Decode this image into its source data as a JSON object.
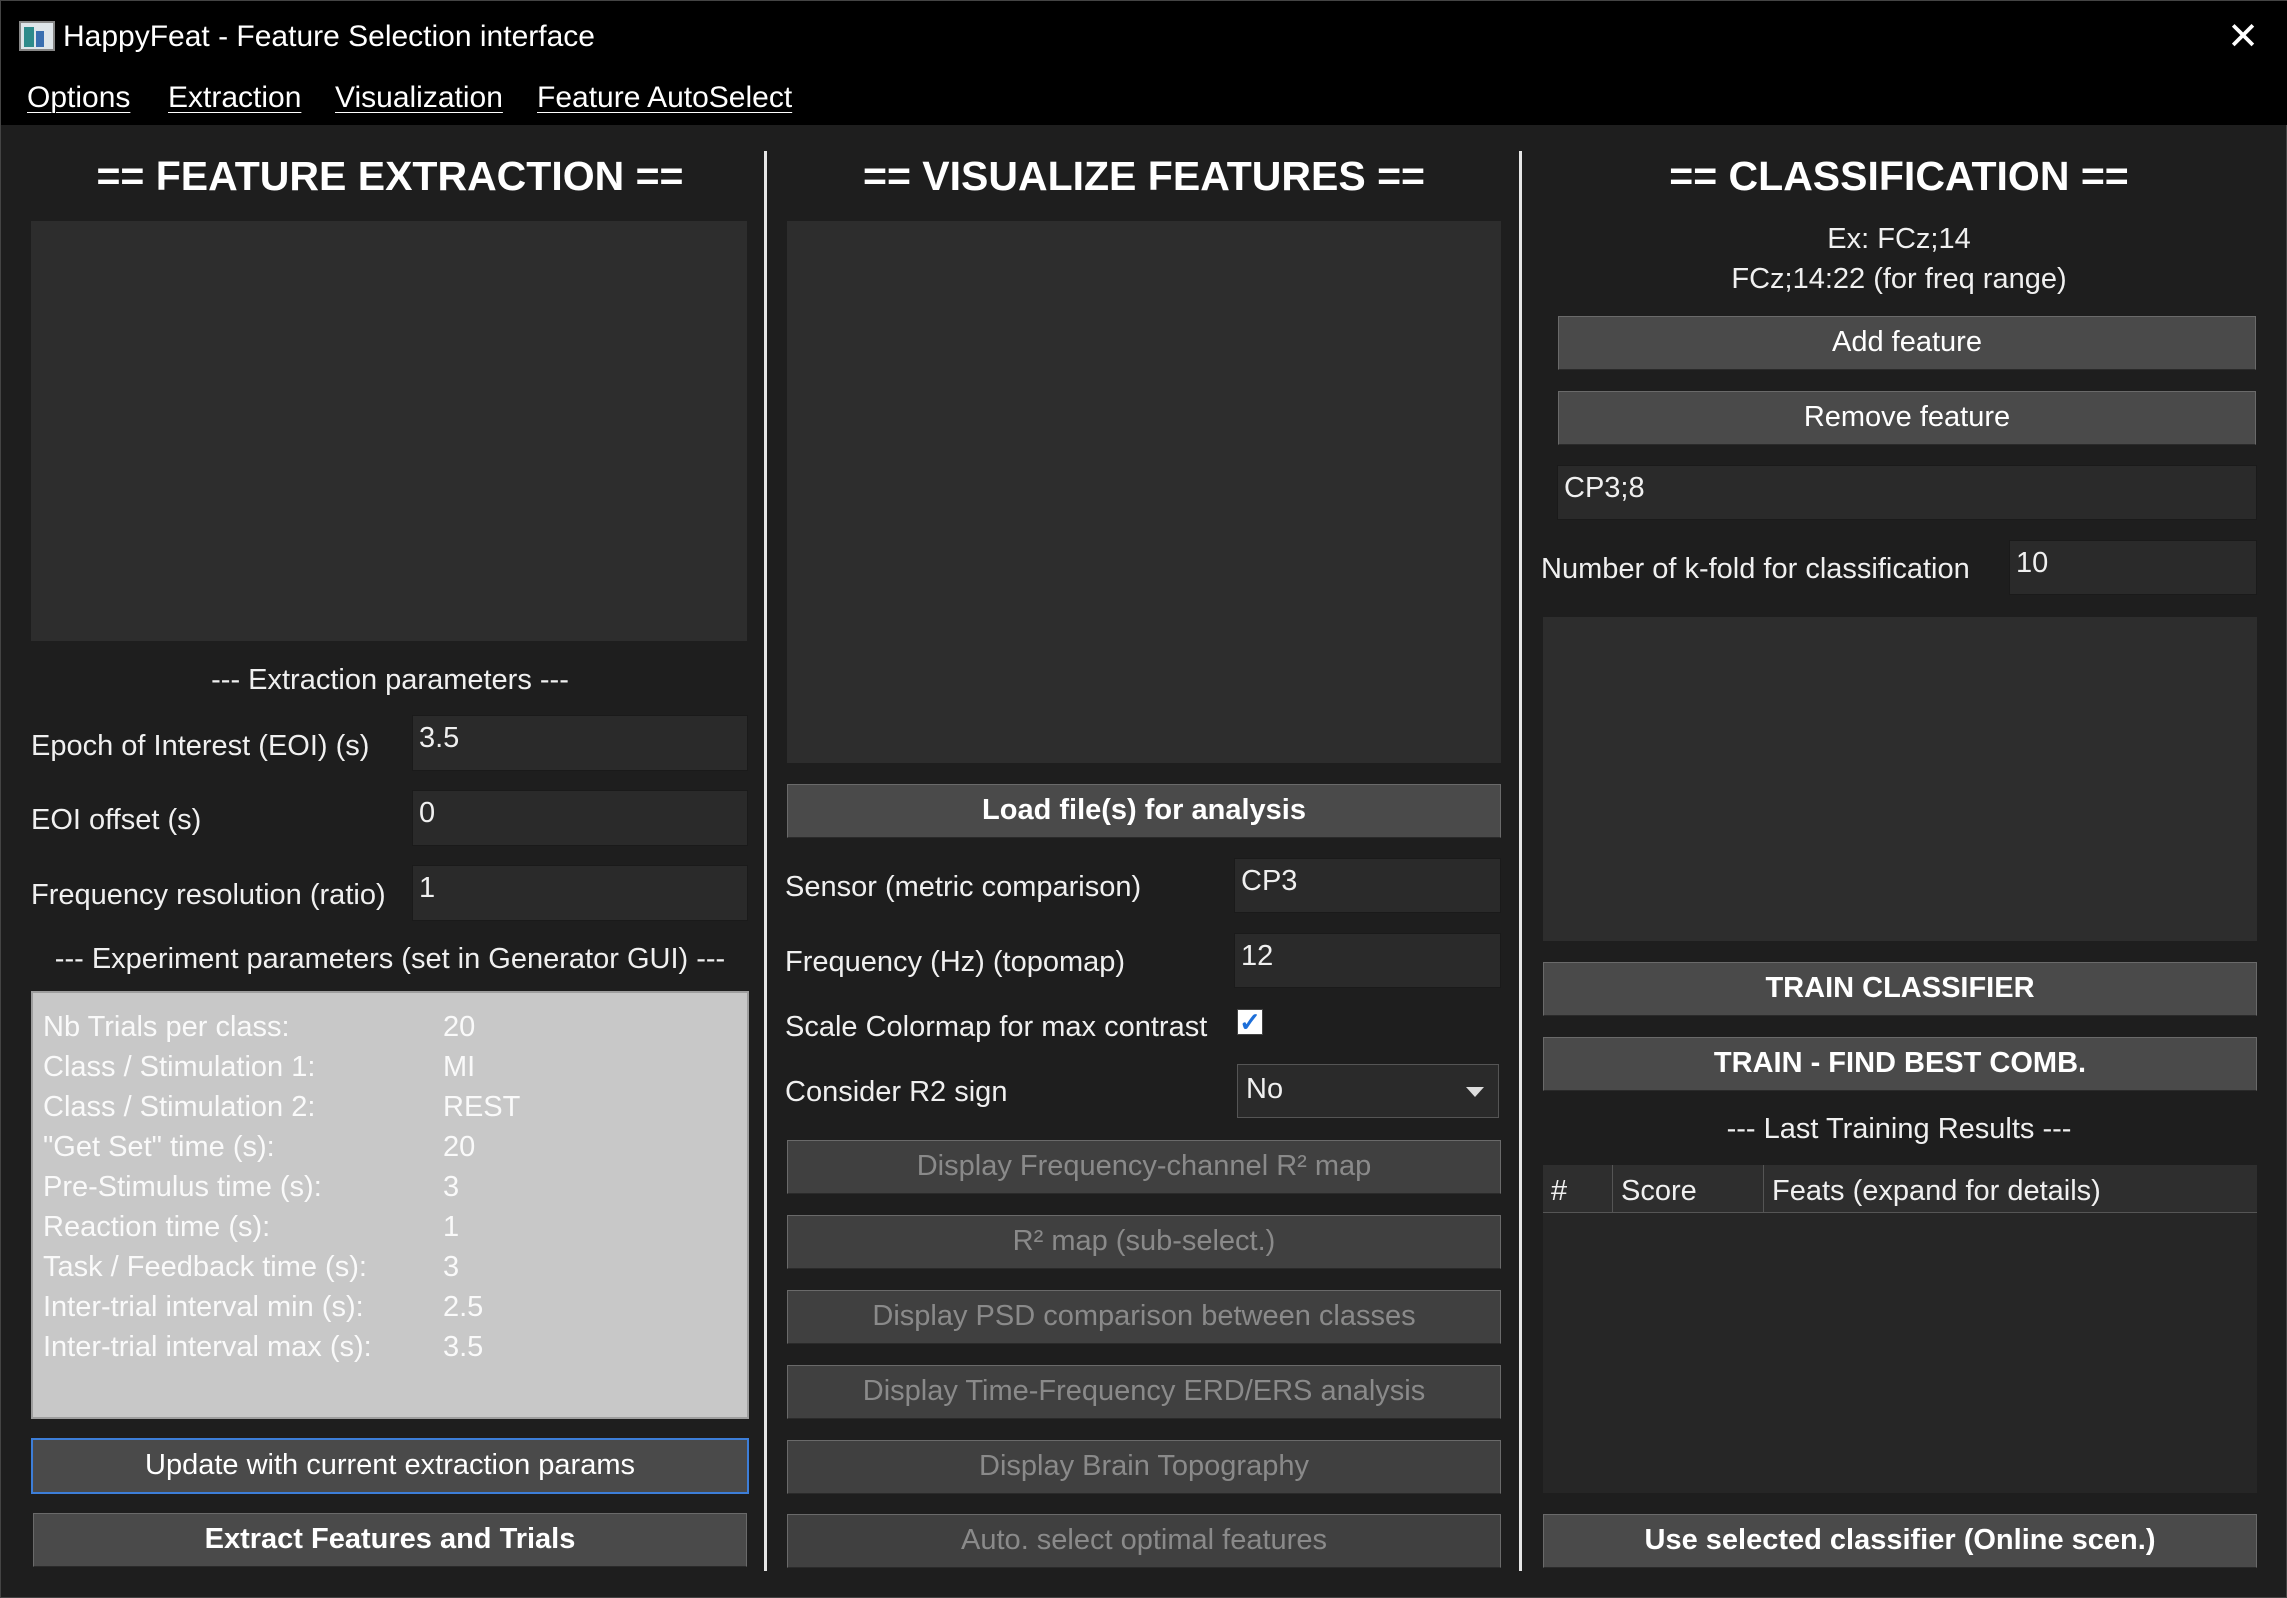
{
  "window": {
    "title": "HappyFeat - Feature Selection interface",
    "close": "✕"
  },
  "menu": [
    "Options",
    "Extraction",
    "Visualization",
    "Feature AutoSelect"
  ],
  "extraction": {
    "heading": "== FEATURE EXTRACTION ==",
    "params_header": "--- Extraction parameters ---",
    "params": [
      {
        "label": "Epoch of Interest (EOI) (s)",
        "value": "3.5"
      },
      {
        "label": "EOI offset (s)",
        "value": "0"
      },
      {
        "label": "Frequency resolution (ratio)",
        "value": "1"
      }
    ],
    "experiment_header": "--- Experiment parameters (set in Generator GUI) ---",
    "experiment": [
      {
        "label": "Nb Trials per class:",
        "value": "20"
      },
      {
        "label": "Class / Stimulation 1:",
        "value": "MI"
      },
      {
        "label": "Class / Stimulation 2:",
        "value": "REST"
      },
      {
        "label": "\"Get Set\" time (s):",
        "value": "20"
      },
      {
        "label": "Pre-Stimulus time (s):",
        "value": "3"
      },
      {
        "label": "Reaction time (s):",
        "value": "1"
      },
      {
        "label": "Task / Feedback time (s):",
        "value": "3"
      },
      {
        "label": "Inter-trial interval min (s):",
        "value": "2.5"
      },
      {
        "label": "Inter-trial interval max (s):",
        "value": "3.5"
      }
    ],
    "update_button": "Update with current extraction params",
    "extract_button": "Extract Features and Trials"
  },
  "visualize": {
    "heading": "== VISUALIZE FEATURES ==",
    "load_button": "Load file(s) for analysis",
    "sensor_label": "Sensor (metric comparison)",
    "sensor_value": "CP3",
    "freq_label": "Frequency (Hz) (topomap)",
    "freq_value": "12",
    "scale_label": "Scale Colormap for max contrast",
    "scale_checked": "✓",
    "r2sign_label": "Consider R2 sign",
    "r2sign_value": "No",
    "buttons": [
      "Display Frequency-channel R² map",
      "R² map (sub-select.)",
      "Display PSD comparison between classes",
      "Display Time-Frequency ERD/ERS analysis",
      "Display Brain Topography",
      "Auto. select optimal features"
    ]
  },
  "classification": {
    "heading": "== CLASSIFICATION ==",
    "hint1": "Ex: FCz;14",
    "hint2": "FCz;14:22 (for freq range)",
    "add_button": "Add feature",
    "remove_button": "Remove feature",
    "feature_value": "CP3;8",
    "kfold_label": "Number of k-fold for classification",
    "kfold_value": "10",
    "train_button": "TRAIN CLASSIFIER",
    "train_best_button": "TRAIN - FIND BEST COMB.",
    "results_header": "--- Last Training Results ---",
    "table_headers": [
      "#",
      "Score",
      "Feats (expand for details)"
    ],
    "use_button": "Use selected classifier (Online scen.)"
  }
}
